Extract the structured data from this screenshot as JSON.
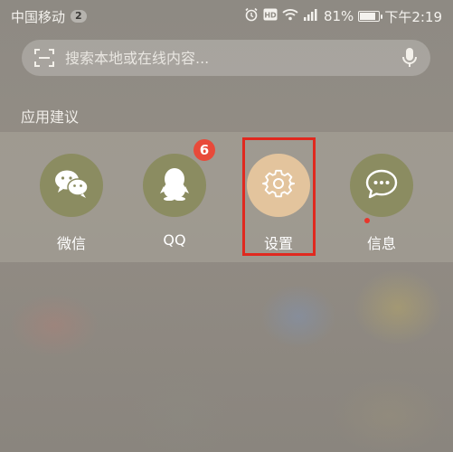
{
  "status_bar": {
    "carrier": "中国移动",
    "sim_count": "2",
    "battery_percent": "81%",
    "time": "下午2:19",
    "battery_level": 0.81,
    "icons": [
      "alarm-icon",
      "hd-icon",
      "wifi-icon",
      "signal-icon",
      "battery-icon"
    ]
  },
  "search": {
    "placeholder": "搜索本地或在线内容..."
  },
  "suggestions": {
    "title": "应用建议",
    "apps": [
      {
        "label": "微信",
        "icon": "wechat-icon",
        "color": "#8b8c61"
      },
      {
        "label": "QQ",
        "icon": "qq-penguin-icon",
        "color": "#8b8c61",
        "badge": "6"
      },
      {
        "label": "设置",
        "icon": "gear-icon",
        "color": "#e3c49d"
      },
      {
        "label": "信息",
        "icon": "message-icon",
        "color": "#8b8c61"
      }
    ]
  },
  "colors": {
    "badge": "#e84a3a",
    "highlight": "#e0291f"
  }
}
